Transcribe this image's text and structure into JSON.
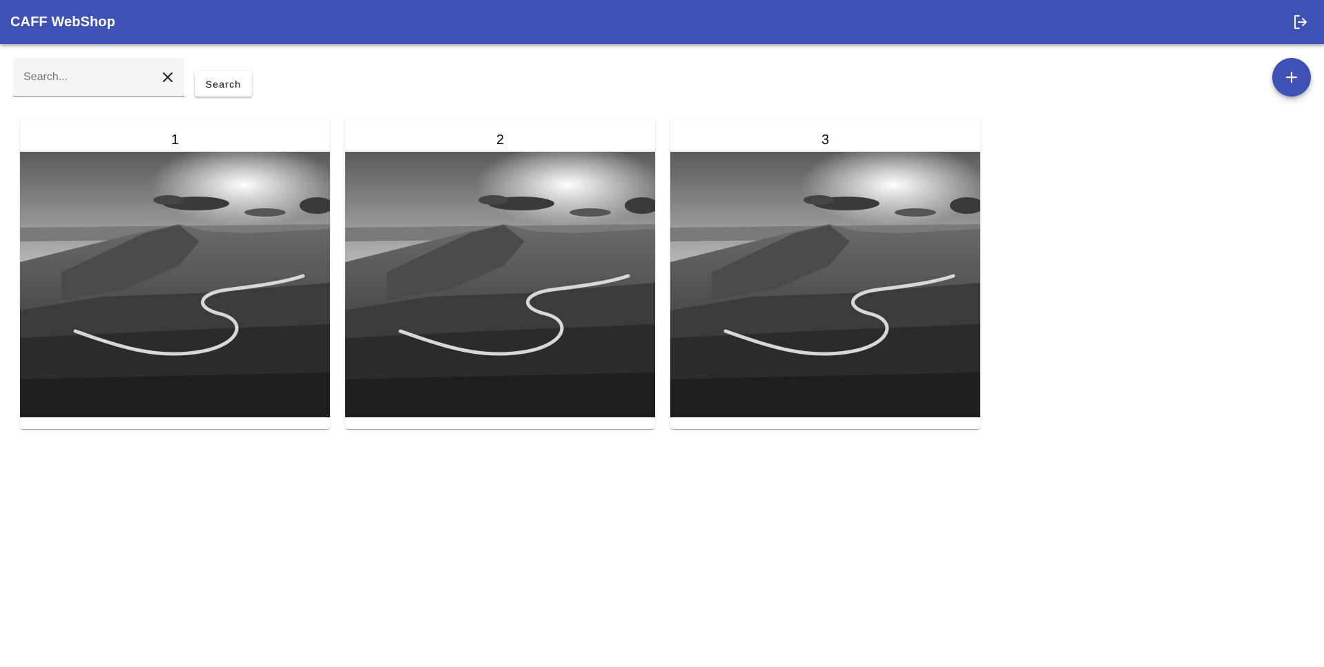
{
  "header": {
    "title": "CAFF WebShop",
    "logout_icon": "logout-icon",
    "background": "#3f51b5"
  },
  "search": {
    "placeholder": "Search...",
    "value": "",
    "clear_icon": "close-icon",
    "button_label": "Search"
  },
  "fab": {
    "icon": "plus-icon",
    "color": "#3f51b5"
  },
  "cards": [
    {
      "title": "1",
      "image": "grayscale mountain landscape with winding road"
    },
    {
      "title": "2",
      "image": "grayscale mountain landscape with winding road"
    },
    {
      "title": "3",
      "image": "grayscale mountain landscape with winding road"
    }
  ]
}
